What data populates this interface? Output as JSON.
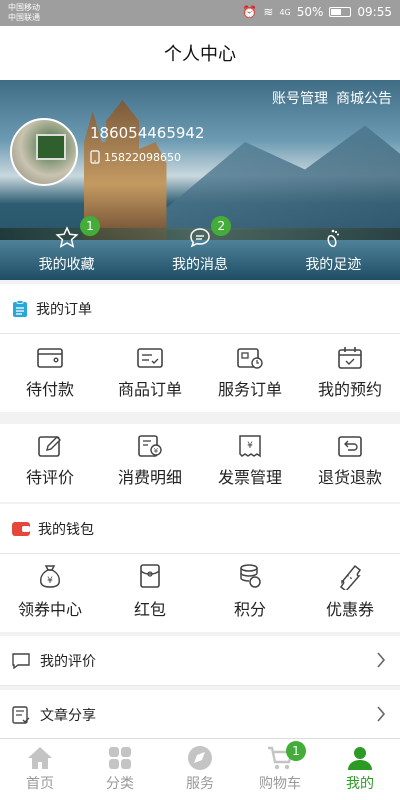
{
  "status": {
    "carrier1": "中国移动",
    "carrier2": "中国联通",
    "network": "4G",
    "battery": "50%",
    "time": "09:55"
  },
  "header": {
    "title": "个人中心"
  },
  "hero": {
    "account_link": "账号管理",
    "announce_link": "商城公告",
    "username": "18605446594​2",
    "phone": "15822098650",
    "stats": [
      {
        "label": "我的收藏",
        "badge": "1",
        "icon": "star-icon"
      },
      {
        "label": "我的消息",
        "badge": "2",
        "icon": "message-icon"
      },
      {
        "label": "我的足迹",
        "badge": "",
        "icon": "footprint-icon"
      }
    ]
  },
  "orders": {
    "title": "我的订单",
    "row1": [
      {
        "label": "待付款"
      },
      {
        "label": "商品订单"
      },
      {
        "label": "服务订单"
      },
      {
        "label": "我的预约"
      }
    ],
    "row2": [
      {
        "label": "待评价"
      },
      {
        "label": "消费明细"
      },
      {
        "label": "发票管理"
      },
      {
        "label": "退货退款"
      }
    ]
  },
  "wallet": {
    "title": "我的钱包",
    "items": [
      {
        "label": "领券中心"
      },
      {
        "label": "红包"
      },
      {
        "label": "积分"
      },
      {
        "label": "优惠券"
      }
    ]
  },
  "list": [
    {
      "label": "我的评价"
    },
    {
      "label": "文章分享"
    }
  ],
  "tabbar": {
    "items": [
      {
        "label": "首页"
      },
      {
        "label": "分类"
      },
      {
        "label": "服务"
      },
      {
        "label": "购物车",
        "badge": "1"
      },
      {
        "label": "我的"
      }
    ]
  },
  "colors": {
    "accent": "#2e9a26",
    "badge": "#44ad3a",
    "orders_icon": "#2aa7d9",
    "wallet_icon": "#e6473b"
  }
}
